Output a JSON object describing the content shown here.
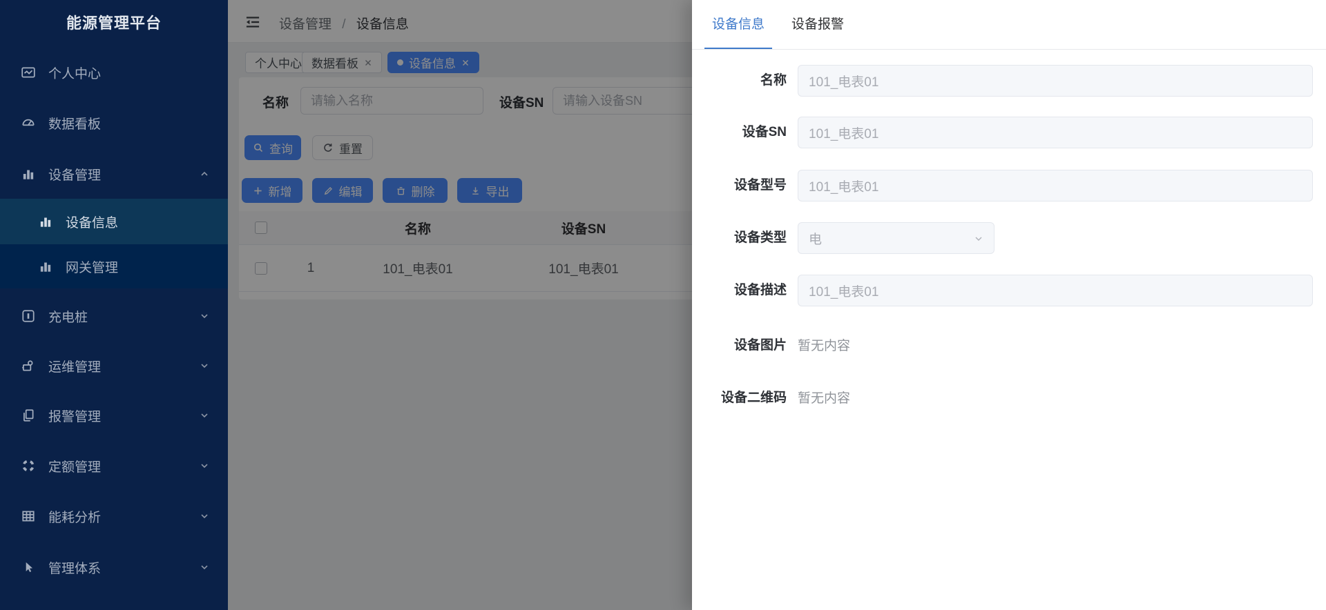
{
  "app": {
    "title": "能源管理平台"
  },
  "sidebar": {
    "items": [
      {
        "label": "个人中心",
        "icon": "profile-icon"
      },
      {
        "label": "数据看板",
        "icon": "dashboard-icon"
      },
      {
        "label": "设备管理",
        "icon": "bar-chart-icon",
        "expanded": true,
        "children": [
          {
            "label": "设备信息",
            "icon": "bar-chart-icon",
            "active": true
          },
          {
            "label": "网关管理",
            "icon": "bar-chart-icon"
          }
        ]
      },
      {
        "label": "充电桩",
        "icon": "charging-pile-icon"
      },
      {
        "label": "运维管理",
        "icon": "ops-icon"
      },
      {
        "label": "报警管理",
        "icon": "alarm-docs-icon"
      },
      {
        "label": "定额管理",
        "icon": "quota-ring-icon"
      },
      {
        "label": "能耗分析",
        "icon": "energy-grid-icon"
      },
      {
        "label": "管理体系",
        "icon": "pointer-icon"
      }
    ]
  },
  "header": {
    "breadcrumb": {
      "parent": "设备管理",
      "separator": "/",
      "current": "设备信息"
    }
  },
  "tags": {
    "items": [
      {
        "label": "个人中心"
      },
      {
        "label": "数据看板",
        "closable": true
      },
      {
        "label": "设备信息",
        "closable": true,
        "active": true
      }
    ]
  },
  "search": {
    "name_label": "名称",
    "name_placeholder": "请输入名称",
    "sn_label": "设备SN",
    "sn_placeholder": "请输入设备SN",
    "query_label": "查询",
    "reset_label": "重置"
  },
  "toolbar": {
    "add_label": "新增",
    "edit_label": "编辑",
    "delete_label": "删除",
    "export_label": "导出"
  },
  "table": {
    "columns": {
      "name": "名称",
      "sn": "设备SN"
    },
    "rows": [
      {
        "index": "1",
        "name": "101_电表01",
        "sn": "101_电表01"
      }
    ]
  },
  "drawer": {
    "tabs": {
      "info": "设备信息",
      "alarm": "设备报警"
    },
    "fields": [
      {
        "label": "名称",
        "value": "101_电表01",
        "type": "input"
      },
      {
        "label": "设备SN",
        "value": "101_电表01",
        "type": "input"
      },
      {
        "label": "设备型号",
        "value": "101_电表01",
        "type": "input"
      },
      {
        "label": "设备类型",
        "value": "电",
        "type": "select"
      },
      {
        "label": "设备描述",
        "value": "101_电表01",
        "type": "input"
      },
      {
        "label": "设备图片",
        "value": "暂无内容",
        "type": "text"
      },
      {
        "label": "设备二维码",
        "value": "暂无内容",
        "type": "text"
      }
    ]
  },
  "colors": {
    "primary": "#4e8cff",
    "drawer_tab_active": "#3e79ca",
    "sidebar_bg": "#0a2148",
    "sidebar_submenu_bg": "#00234c",
    "sidebar_active_bg": "#0d3757",
    "mask": "rgba(0,0,0,0.45)"
  }
}
